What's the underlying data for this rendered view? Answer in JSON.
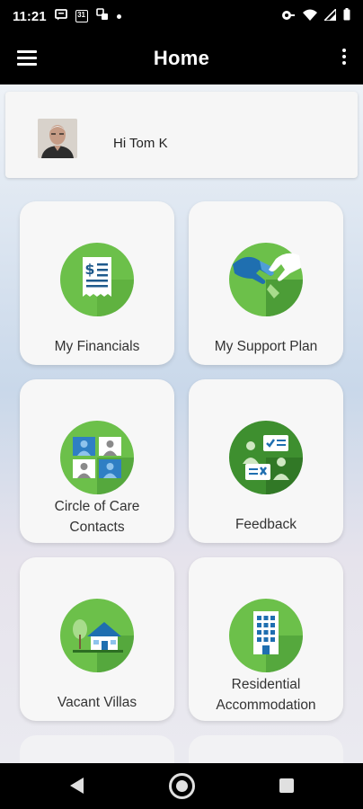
{
  "status_bar": {
    "time": "11:21",
    "calendar_date": "31",
    "icons": [
      "message-icon",
      "calendar-icon",
      "apps-icon",
      "dot-icon",
      "vpn-key-icon",
      "wifi-icon",
      "signal-icon",
      "battery-icon"
    ]
  },
  "app_bar": {
    "title": "Home",
    "menu_icon": "hamburger-menu-icon",
    "overflow_icon": "more-vertical-icon"
  },
  "profile": {
    "greeting": "Hi Tom K"
  },
  "tiles": [
    {
      "label": "My Financials",
      "icon": "financial-statement-icon"
    },
    {
      "label": "My Support Plan",
      "icon": "helping-hands-icon"
    },
    {
      "label": "Circle of Care Contacts",
      "line1": "Circle of Care",
      "line2": "Contacts",
      "icon": "contacts-grid-icon"
    },
    {
      "label": "Feedback",
      "icon": "feedback-chat-icon"
    },
    {
      "label": "Vacant Villas",
      "icon": "villa-house-icon"
    },
    {
      "label": "Residential Accommodation",
      "line1": "Residential",
      "line2": "Accommodation",
      "icon": "apartment-building-icon"
    }
  ],
  "colors": {
    "accent_green": "#6cc04a",
    "dark_green": "#3e8f2f",
    "bar_black": "#000000",
    "tile_bg": "#f7f7f7"
  }
}
